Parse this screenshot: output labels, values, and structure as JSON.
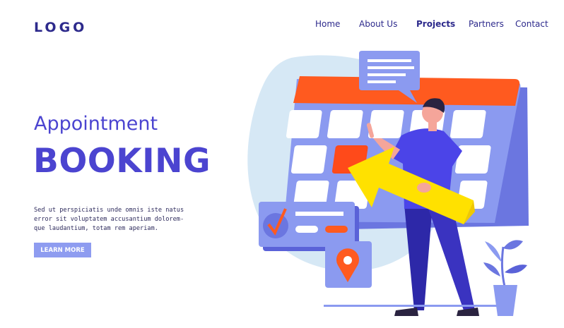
{
  "header": {
    "logo": "LOGO",
    "nav": [
      {
        "label": "Home",
        "active": false
      },
      {
        "label": "About Us",
        "active": false
      },
      {
        "label": "Projects",
        "active": true
      },
      {
        "label": "Partners",
        "active": false
      },
      {
        "label": "Contact",
        "active": false
      }
    ]
  },
  "hero": {
    "subtitle": "Appointment",
    "title": "BOOKING",
    "body_lines": [
      "Sed ut perspiciatis unde omnis iste natus",
      "error sit voluptatem accusantium dolorem-",
      "que laudantium, totam rem aperiam."
    ],
    "cta_label": "LEARN MORE"
  },
  "illustration": {
    "icons": [
      "calendar-icon",
      "chat-bubble-icon",
      "checkmark-card-icon",
      "location-pin-icon",
      "arrow-icon",
      "person-figure",
      "plant-icon"
    ]
  },
  "colors": {
    "primary": "#4b44d0",
    "nav_text": "#2d2a8c",
    "button": "#8e9cf0",
    "calendar_header": "#ff5a1f",
    "calendar_body": "#8b9af0",
    "blob": "#d6e8f5",
    "arrow": "#ffe100",
    "accent_red": "#ff4a1a"
  }
}
